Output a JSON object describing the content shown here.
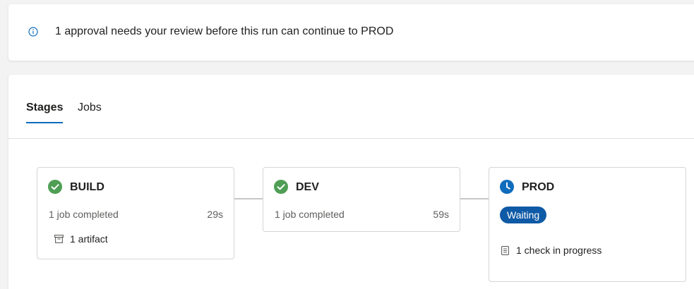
{
  "banner": {
    "icon": "info-icon",
    "message": "1 approval needs your review before this run can continue to PROD"
  },
  "tabs": [
    {
      "label": "Stages",
      "selected": true
    },
    {
      "label": "Jobs",
      "selected": false
    }
  ],
  "stages": {
    "build": {
      "name": "BUILD",
      "status_icon": "success-check-icon",
      "summary": "1 job completed",
      "duration": "29s",
      "artifact_label": "1 artifact"
    },
    "dev": {
      "name": "DEV",
      "status_icon": "success-check-icon",
      "summary": "1 job completed",
      "duration": "59s"
    },
    "prod": {
      "name": "PROD",
      "status_icon": "clock-icon",
      "status_badge": "Waiting",
      "check_label": "1 check in progress"
    }
  },
  "colors": {
    "success": "#4f9e55",
    "waiting": "#0f6cbd",
    "badge": "#0f5aa6",
    "accent": "#0f6cbd"
  }
}
